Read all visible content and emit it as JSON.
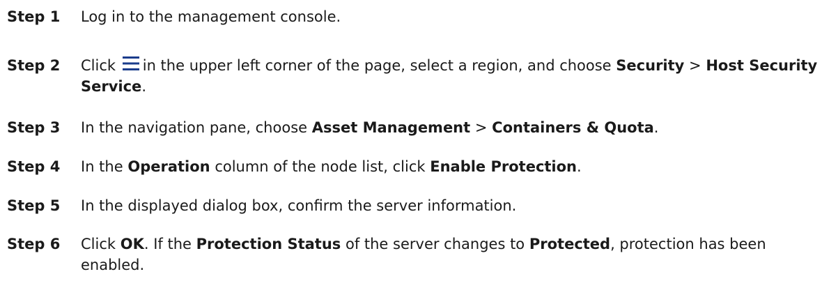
{
  "steps": [
    {
      "label": "Step 1",
      "parts": [
        "Log in to the management console."
      ]
    },
    {
      "label": "Step 2",
      "parts": [
        "Click",
        "in the upper left corner of the page, select a region, and choose",
        "Security",
        ">",
        "Host Security Service",
        "."
      ],
      "icon": "menu-icon"
    },
    {
      "label": "Step 3",
      "parts": [
        "In the navigation pane, choose",
        "Asset Management",
        ">",
        "Containers & Quota",
        "."
      ]
    },
    {
      "label": "Step 4",
      "parts": [
        "In the",
        "Operation",
        "column of the node list, click",
        "Enable Protection",
        "."
      ]
    },
    {
      "label": "Step 5",
      "parts": [
        "In the displayed dialog box, confirm the server information."
      ]
    },
    {
      "label": "Step 6",
      "parts": [
        "Click",
        "OK",
        ". If the",
        "Protection Status",
        "of the server changes to",
        "Protected",
        ", protection has been enabled."
      ]
    }
  ],
  "colors": {
    "text": "#1a1a1a",
    "icon": "#1a3c8c"
  }
}
